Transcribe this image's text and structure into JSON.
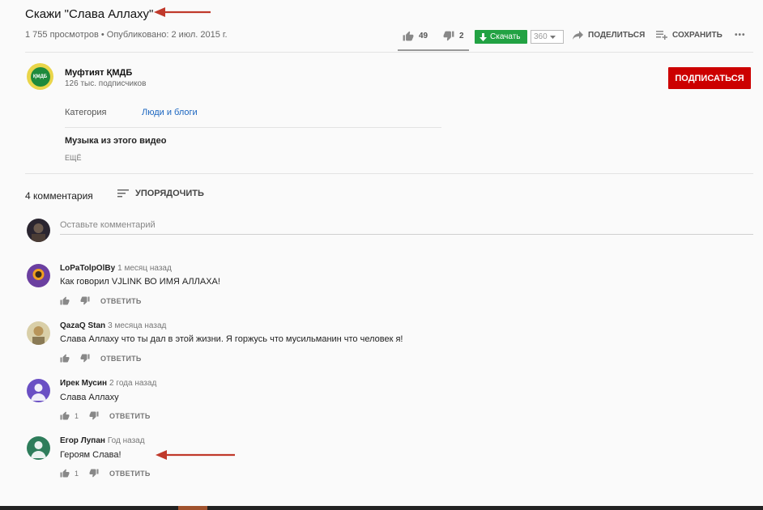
{
  "video": {
    "title": "Скажи \"Слава Аллаху\"",
    "meta": "1 755 просмотров • Опубликовано: 2 июл. 2015 г.",
    "likes": "49",
    "dislikes": "2",
    "download_label": "Скачать",
    "quality": "360",
    "share_label": "ПОДЕЛИТЬСЯ",
    "save_label": "СОХРАНИТЬ",
    "more_label": "•••"
  },
  "channel": {
    "name": "Муфтият ҚМДБ",
    "subscribers": "126 тыс. подписчиков",
    "logo_text": "ҚМДБ",
    "subscribe_label": "ПОДПИСАТЬСЯ"
  },
  "details": {
    "category_label": "Категория",
    "category_value": "Люди и блоги",
    "music_label": "Музыка из этого видео",
    "more_label": "ЕЩЁ"
  },
  "comments": {
    "count_label": "4 комментария",
    "sort_label": "УПОРЯДОЧИТЬ",
    "add_placeholder": "Оставьте комментарий",
    "reply_label": "ОТВЕТИТЬ",
    "items": [
      {
        "author": "LoPaTolpOlBy",
        "time": "1 месяц назад",
        "text": "Как говорил VJLINK ВО ИМЯ АЛЛАХА!",
        "likes": ""
      },
      {
        "author": "QazaQ Stan",
        "time": "3 месяца назад",
        "text": "Слава Аллаху что ты дал в этой жизни. Я горжусь что мусильманин что человек я!",
        "likes": ""
      },
      {
        "author": "Ирек Мусин",
        "time": "2 года назад",
        "text": "Слава Аллаху",
        "likes": "1"
      },
      {
        "author": "Егор Лупан",
        "time": "Год назад",
        "text": "Героям Слава!",
        "likes": "1"
      }
    ]
  },
  "colors": {
    "subscribe": "#cc0000",
    "download": "#22a243",
    "link": "#1a65c0",
    "annotation_arrow": "#c0392b"
  }
}
